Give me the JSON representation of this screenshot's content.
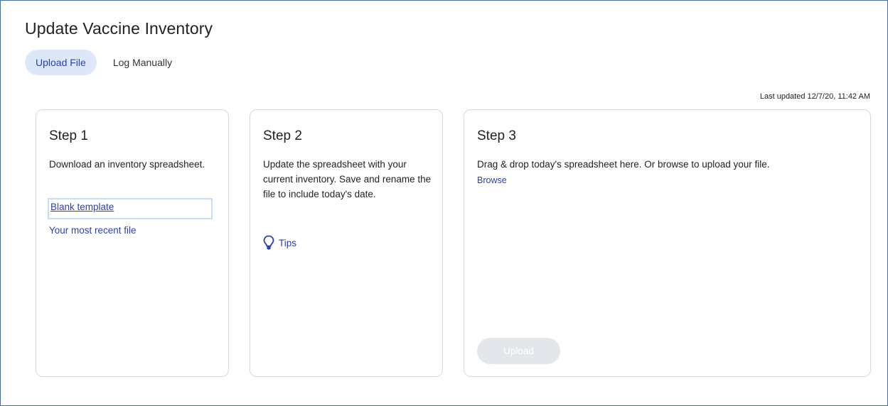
{
  "page": {
    "title": "Update Vaccine Inventory"
  },
  "tabs": [
    {
      "label": "Upload File",
      "active": true
    },
    {
      "label": "Log Manually",
      "active": false
    }
  ],
  "last_updated": "Last updated 12/7/20, 11:42 AM",
  "steps": [
    {
      "title": "Step 1",
      "description": "Download an inventory spreadsheet.",
      "links": [
        "Blank template",
        "Your most recent file"
      ]
    },
    {
      "title": "Step 2",
      "description": "Update the spreadsheet with your current inventory. Save and rename the file to include today's date.",
      "tips_label": "Tips",
      "tips_icon": "lightbulb-icon"
    },
    {
      "title": "Step 3",
      "description": "Drag & drop today's spreadsheet here. Or browse to upload your file.",
      "browse_label": "Browse",
      "upload_label": "Upload",
      "upload_enabled": false
    }
  ],
  "colors": {
    "link": "#2b3fb4",
    "active_tab_bg": "#dce8fa",
    "card_border": "#d8d8d8",
    "disabled_button": "#e3e6ea",
    "frame_border": "#4a6fa5"
  }
}
